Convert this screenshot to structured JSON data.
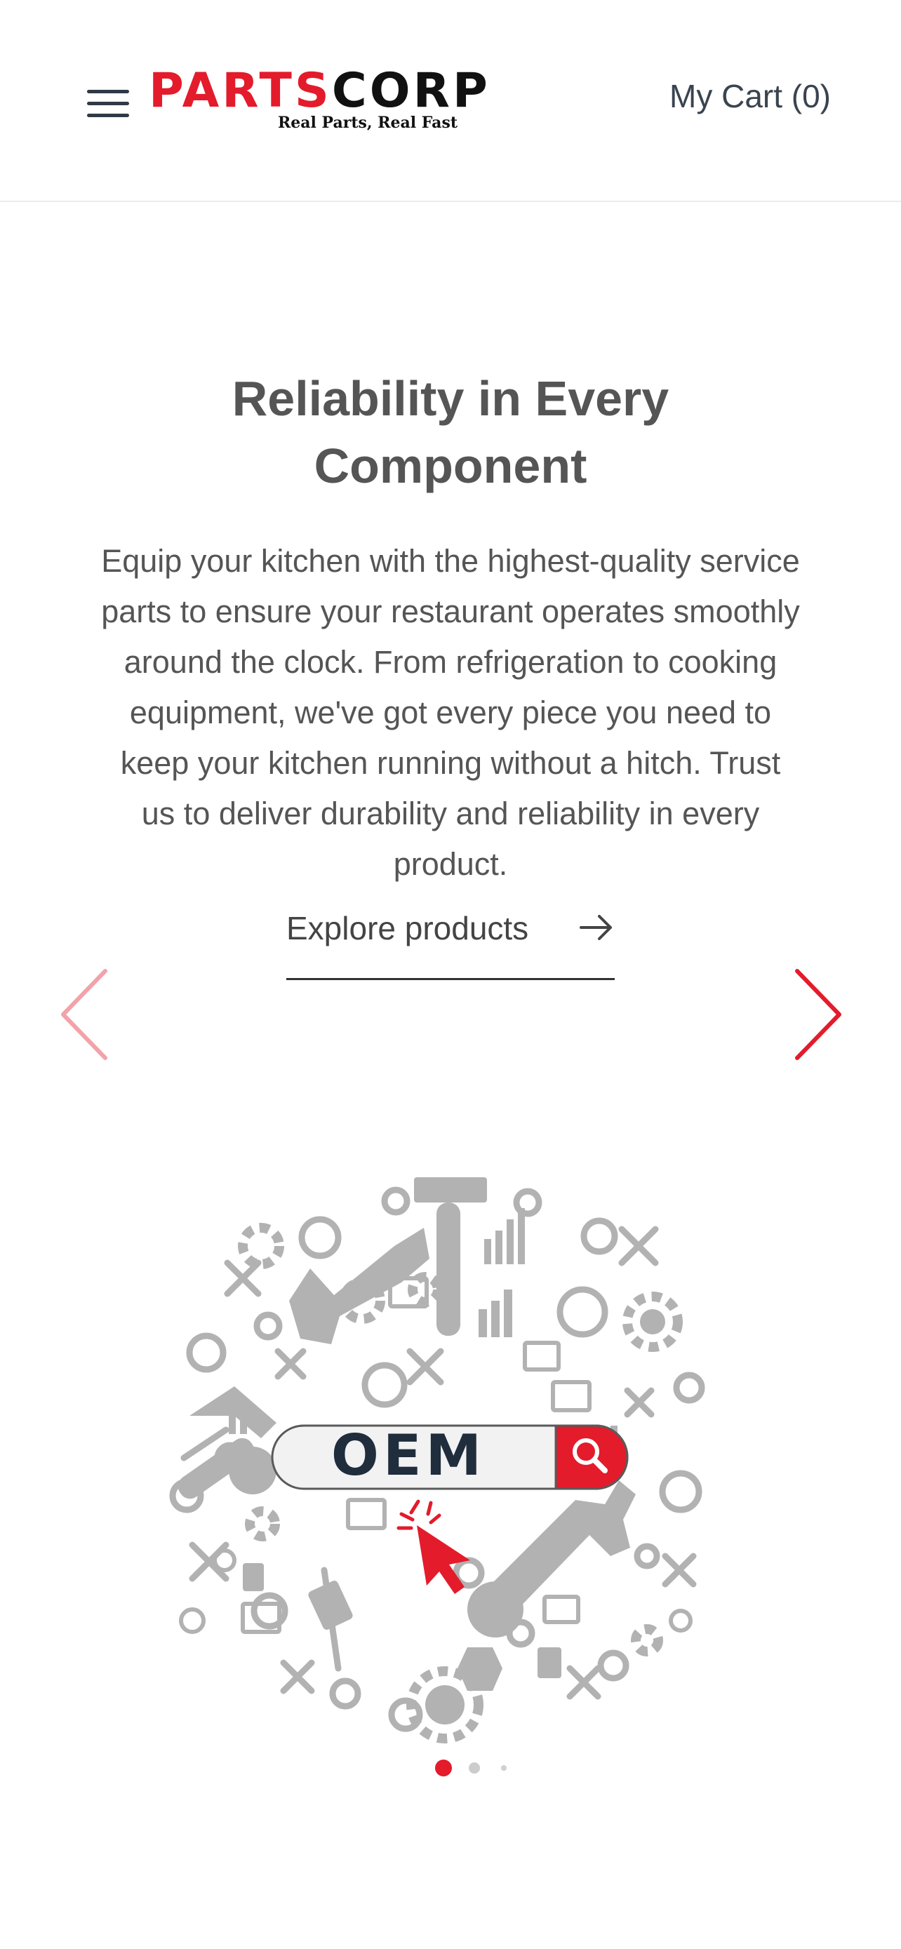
{
  "header": {
    "logo_part1": "PARTS",
    "logo_part2": "CORP",
    "tagline": "Real Parts, Real Fast",
    "cart_label": "My Cart (0)"
  },
  "hero": {
    "title": "Reliability in Every Component",
    "description": "Equip your kitchen with the highest-quality service parts to ensure your restaurant operates smoothly around the clock. From refrigeration to cooking equipment, we've got every piece you need to keep your kitchen running without a hitch. Trust us to deliver durability and reliability in every product.",
    "cta_label": "Explore products"
  },
  "illustration": {
    "search_text": "OEM"
  },
  "carousel": {
    "slide_count": 3,
    "active_index": 0
  },
  "colors": {
    "brand_red": "#e31b2b",
    "text_dark": "#2f3a45",
    "text_gray": "#555555",
    "icon_gray": "#b2b2b2",
    "navy": "#1f2d3d"
  }
}
